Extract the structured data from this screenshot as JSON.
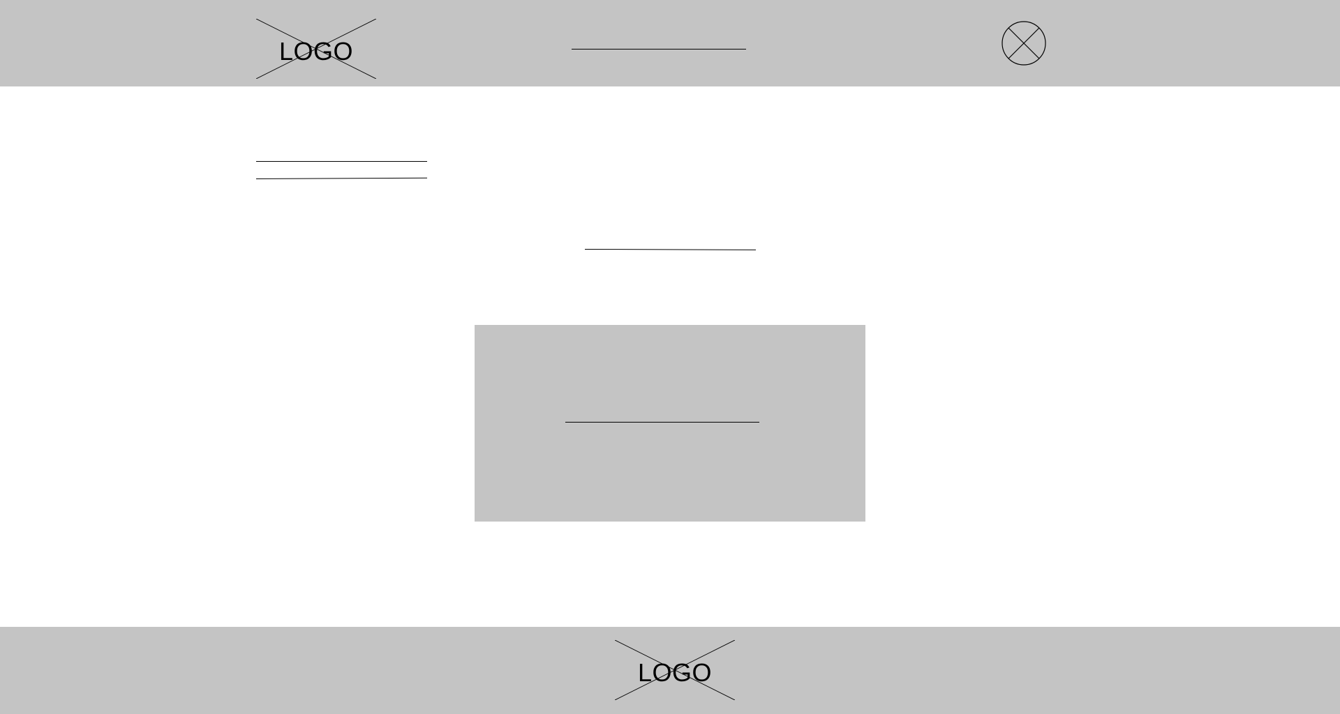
{
  "header": {
    "logo_text": "LOGO",
    "nav_placeholder": "",
    "close_icon": "circle-x-icon"
  },
  "main": {
    "heading_line_1": "",
    "heading_line_2": "",
    "subheading": "",
    "card": {
      "text": ""
    }
  },
  "footer": {
    "logo_text": "LOGO"
  },
  "colors": {
    "bar_background": "#c4c4c4",
    "page_background": "#ffffff",
    "line": "#000000"
  }
}
